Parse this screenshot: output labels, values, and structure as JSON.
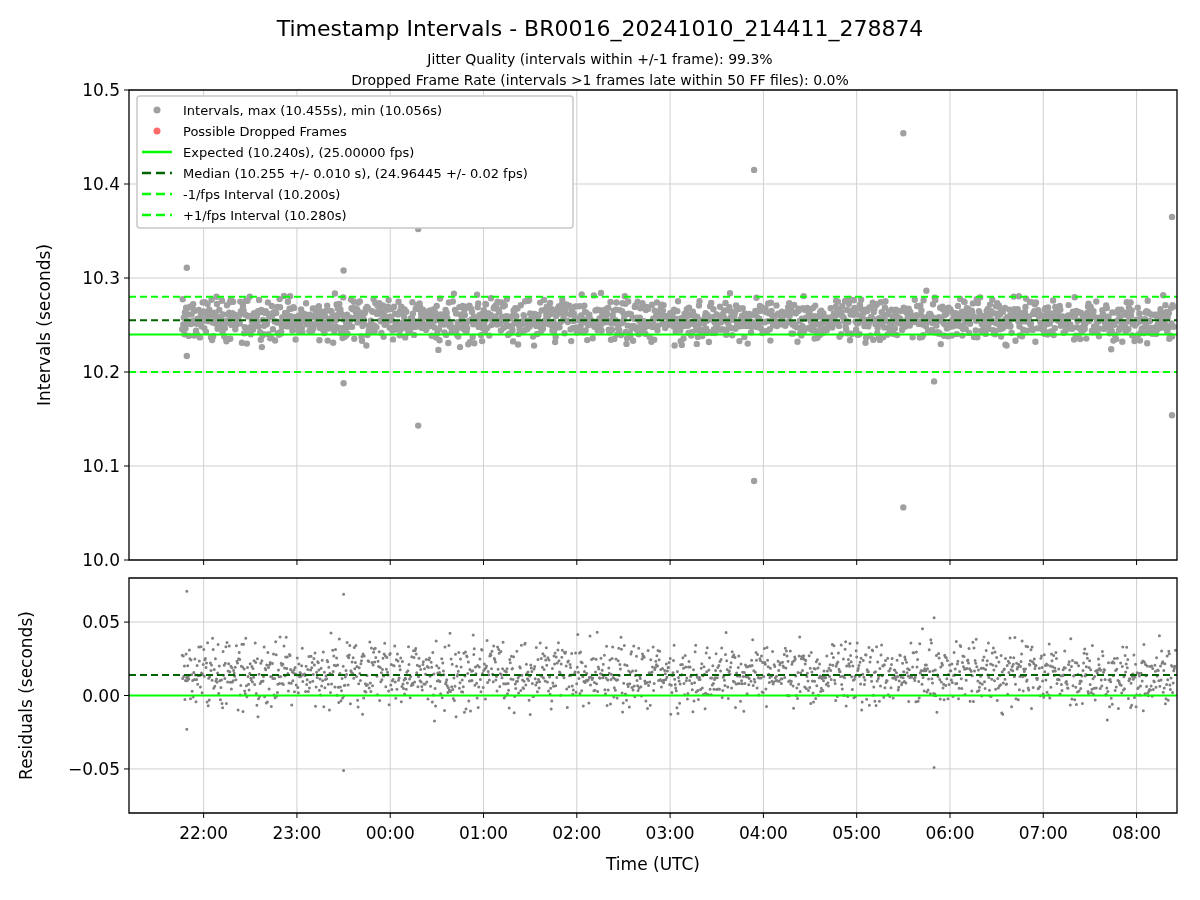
{
  "figure": {
    "title": "Timestamp Intervals - BR0016_20241010_214411_278874",
    "subtitles": [
      "Jitter Quality (intervals within +/-1 frame): 99.3%",
      "Dropped Frame Rate (intervals >1 frames late within 50 FF files): 0.0%"
    ]
  },
  "intervals_chart": {
    "legend_markers": [
      {
        "label": "Intervals, max (10.455s), min (10.056s)",
        "color": "#a0a0a0"
      },
      {
        "label": "Possible Dropped Frames",
        "color": "#ff6a6a"
      }
    ],
    "chart_data": {
      "type": "line",
      "ylabel": "Intervals (seconds)",
      "grid": true,
      "x": [
        "2024-10-10T21:12",
        "2024-10-11T08:26"
      ],
      "xlim": [
        "2024-10-10T21:12",
        "2024-10-11T08:26"
      ],
      "ylim": [
        10.0,
        10.5
      ],
      "yticks": [
        {
          "value": 10.0,
          "label": "10.0"
        },
        {
          "value": 10.1,
          "label": "10.1"
        },
        {
          "value": 10.2,
          "label": "10.2"
        },
        {
          "value": 10.3,
          "label": "10.3"
        },
        {
          "value": 10.4,
          "label": "10.4"
        },
        {
          "value": 10.5,
          "label": "10.5"
        }
      ],
      "series": [
        {
          "name": "Expected (10.240s), (25.00000 fps)",
          "color": "#00ff00",
          "line_style": "solid",
          "values": [
            10.24,
            10.24
          ]
        },
        {
          "name": "Median (10.255 +/- 0.010 s), (24.96445 +/- 0.02 fps)",
          "color": "#006400",
          "line_style": "dashed",
          "values": [
            10.255,
            10.255
          ]
        },
        {
          "name": "-1/fps Interval (10.200s)",
          "color": "#00ff00",
          "line_style": "dashed",
          "values": [
            10.2,
            10.2
          ]
        },
        {
          "name": "+1/fps Interval (10.280s)",
          "color": "#00ff00",
          "line_style": "dashed",
          "values": [
            10.28,
            10.28
          ]
        }
      ]
    }
  },
  "residuals_chart": {
    "chart_data": {
      "type": "line",
      "xlabel": "Time (UTC)",
      "ylabel": "Residuals (seconds)",
      "grid": true,
      "x": [
        "2024-10-10T21:12",
        "2024-10-11T08:26"
      ],
      "xlim": [
        "2024-10-10T21:12",
        "2024-10-11T08:26"
      ],
      "ylim": [
        -0.08,
        0.08
      ],
      "xticks": [
        {
          "value": "2024-10-10T22:00",
          "label": "22:00"
        },
        {
          "value": "2024-10-10T23:00",
          "label": "23:00"
        },
        {
          "value": "2024-10-11T00:00",
          "label": "00:00"
        },
        {
          "value": "2024-10-11T01:00",
          "label": "01:00"
        },
        {
          "value": "2024-10-11T02:00",
          "label": "02:00"
        },
        {
          "value": "2024-10-11T03:00",
          "label": "03:00"
        },
        {
          "value": "2024-10-11T04:00",
          "label": "04:00"
        },
        {
          "value": "2024-10-11T05:00",
          "label": "05:00"
        },
        {
          "value": "2024-10-11T06:00",
          "label": "06:00"
        },
        {
          "value": "2024-10-11T07:00",
          "label": "07:00"
        },
        {
          "value": "2024-10-11T08:00",
          "label": "08:00"
        }
      ],
      "yticks": [
        {
          "value": -0.05,
          "label": "−0.05"
        },
        {
          "value": 0.0,
          "label": "0.00"
        },
        {
          "value": 0.05,
          "label": "0.05"
        }
      ],
      "series": [
        {
          "color": "#00ff00",
          "line_style": "solid",
          "values": [
            0,
            0
          ]
        },
        {
          "color": "#006400",
          "line_style": "dashed",
          "values": [
            0.014,
            0.014
          ]
        }
      ]
    }
  }
}
